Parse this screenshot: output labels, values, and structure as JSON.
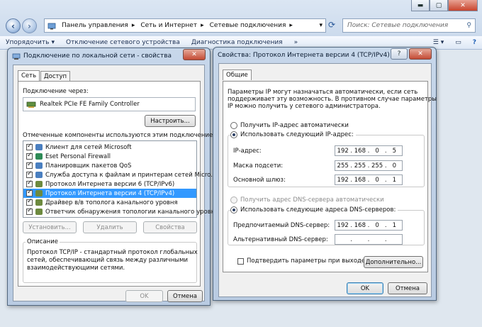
{
  "explorer": {
    "breadcrumb": [
      "Панель управления",
      "Сеть и Интернет",
      "Сетевые подключения"
    ],
    "search_placeholder": "Поиск: Сетевые подключения",
    "toolbar": {
      "organize": "Упорядочить",
      "disable_device": "Отключение сетевого устройства",
      "diagnose": "Диагностика подключения",
      "more": "»"
    },
    "window_controls": {
      "minimize": "▬",
      "maximize": "▢",
      "close": "✕"
    }
  },
  "props": {
    "title": "Подключение по локальной сети - свойства",
    "close": "✕",
    "tabs": [
      "Сеть",
      "Доступ"
    ],
    "connect_using_label": "Подключение через:",
    "adapter_name": "Realtek PCIe FE Family Controller",
    "configure_btn": "Настроить...",
    "components_label": "Отмеченные компоненты используются этим подключением:",
    "components": [
      {
        "name": "Клиент для сетей Microsoft",
        "checked": true,
        "color": "#4a7fc0"
      },
      {
        "name": "Eset Personal Firewall",
        "checked": true,
        "color": "#2e8b57"
      },
      {
        "name": "Планировщик пакетов QoS",
        "checked": true,
        "color": "#4a7fc0"
      },
      {
        "name": "Служба доступа к файлам и принтерам сетей Micro...",
        "checked": true,
        "color": "#4a7fc0"
      },
      {
        "name": "Протокол Интернета версии 6 (TCP/IPv6)",
        "checked": true,
        "color": "#6d8a3f"
      },
      {
        "name": "Протокол Интернета версии 4 (TCP/IPv4)",
        "checked": true,
        "color": "#6d8a3f"
      },
      {
        "name": "Драйвер в/в тополога канального уровня",
        "checked": true,
        "color": "#6d8a3f"
      },
      {
        "name": "Ответчик обнаружения топологии канального уровня",
        "checked": true,
        "color": "#6d8a3f"
      }
    ],
    "selected_index": 5,
    "install_btn": "Установить...",
    "remove_btn": "Удалить",
    "properties_btn": "Свойства",
    "description_label": "Описание",
    "description_text": [
      "Протокол TCP/IP - стандартный протокол глобальных",
      "сетей, обеспечивающий связь между различными",
      "взаимодействующими сетями."
    ],
    "ok_btn": "OK",
    "cancel_btn": "Отмена"
  },
  "ipv4": {
    "title": "Свойства: Протокол Интернета версии 4 (TCP/IPv4)",
    "help": "?",
    "close": "✕",
    "tab": "Общие",
    "intro": [
      "Параметры IP могут назначаться автоматически, если сеть",
      "поддерживает эту возможность. В противном случае параметры",
      "IP можно получить у сетевого администратора."
    ],
    "auto_ip_label": "Получить IP-адрес автоматически",
    "manual_ip_label": "Использовать следующий IP-адрес:",
    "ip_label": "IP-адрес:",
    "ip": [
      "192",
      "168",
      "0",
      "5"
    ],
    "mask_label": "Маска подсети:",
    "mask": [
      "255",
      "255",
      "255",
      "0"
    ],
    "gateway_label": "Основной шлюз:",
    "gateway": [
      "192",
      "168",
      "0",
      "1"
    ],
    "auto_dns_label": "Получить адрес DNS-сервера автоматически",
    "manual_dns_label": "Использовать следующие адреса DNS-серверов:",
    "preferred_dns_label": "Предпочитаемый DNS-сервер:",
    "preferred_dns": [
      "192",
      "168",
      "0",
      "1"
    ],
    "alternate_dns_label": "Альтернативный DNS-сервер:",
    "alternate_dns": [
      "",
      "",
      "",
      ""
    ],
    "validate_label": "Подтвердить параметры при выходе",
    "advanced_btn": "Дополнительно...",
    "ok_btn": "OK",
    "cancel_btn": "Отмена"
  }
}
